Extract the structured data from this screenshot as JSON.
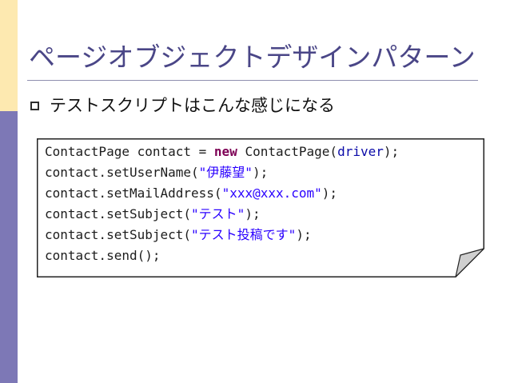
{
  "slide": {
    "title": "ページオブジェクトデザインパターン",
    "bullet": "テストスクリプトはこんな感じになる"
  },
  "code_lines": [
    [
      {
        "t": "ContactPage contact = ",
        "c": "plain"
      },
      {
        "t": "new",
        "c": "kw"
      },
      {
        "t": " ContactPage(",
        "c": "plain"
      },
      {
        "t": "driver",
        "c": "var"
      },
      {
        "t": ");",
        "c": "plain"
      }
    ],
    [
      {
        "t": "contact.setUserName(",
        "c": "plain"
      },
      {
        "t": "\"伊藤望\"",
        "c": "str"
      },
      {
        "t": ");",
        "c": "plain"
      }
    ],
    [
      {
        "t": "contact.setMailAddress(",
        "c": "plain"
      },
      {
        "t": "\"xxx@xxx.com\"",
        "c": "str"
      },
      {
        "t": ");",
        "c": "plain"
      }
    ],
    [
      {
        "t": "contact.setSubject(",
        "c": "plain"
      },
      {
        "t": "\"テスト\"",
        "c": "str"
      },
      {
        "t": ");",
        "c": "plain"
      }
    ],
    [
      {
        "t": "contact.setSubject(",
        "c": "plain"
      },
      {
        "t": "\"テスト投稿です\"",
        "c": "str"
      },
      {
        "t": ");",
        "c": "plain"
      }
    ],
    [
      {
        "t": "contact.send();",
        "c": "plain"
      }
    ]
  ],
  "colors": {
    "title": "#4a4687",
    "accent_top": "#fde9b0",
    "accent_bottom": "#7d78b6",
    "keyword": "#7d0055",
    "string": "#2a00ff",
    "variable": "#0a0aa8"
  }
}
